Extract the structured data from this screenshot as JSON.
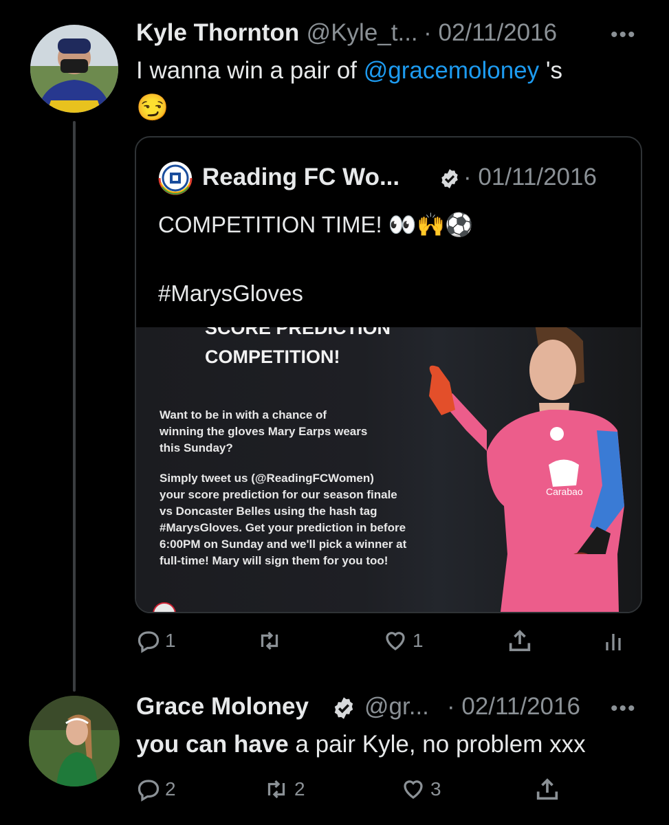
{
  "tweet1": {
    "name": "Kyle Thornton",
    "handle": "@Kyle_t...",
    "date": "· 02/11/2016",
    "more": "•••",
    "text_before": "I wanna win a pair of ",
    "mention": "@gracemoloney",
    "text_after": " 's",
    "emoji": "😏",
    "actions": {
      "reply": "1",
      "retweet": "",
      "like": "1"
    }
  },
  "quote": {
    "name": "Reading FC Wo...",
    "date": "· 01/11/2016",
    "line1": "COMPETITION TIME! 👀🙌⚽",
    "hashtag": "#MarysGloves",
    "image": {
      "heading1": "SCORE PREDICTION",
      "heading2": "COMPETITION!",
      "para1_l1": "Want to be in with a chance of",
      "para1_l2": "winning the gloves Mary Earps wears",
      "para1_l3": "this Sunday?",
      "para2_l1": "Simply tweet us (@ReadingFCWomen)",
      "para2_l2": "your score prediction for our season finale",
      "para2_l3": "vs Doncaster Belles using the hash tag",
      "para2_l4": "#MarysGloves. Get your prediction in before",
      "para2_l5": "6:00PM on Sunday and we'll pick a winner at",
      "para2_l6": "full-time! Mary will sign them for you too!",
      "sponsor": "Carabao"
    }
  },
  "tweet2": {
    "name": "Grace Moloney",
    "handle": "@gr...",
    "date": "· 02/11/2016",
    "more": "•••",
    "text_bold": "you can have",
    "text_rest": " a pair Kyle, no problem xxx",
    "actions": {
      "reply": "2",
      "retweet": "2",
      "like": "3"
    }
  },
  "colors": {
    "background": "#000000",
    "accent": "#1d9bf0",
    "muted": "#8b9196",
    "text": "#e7e9ea"
  }
}
